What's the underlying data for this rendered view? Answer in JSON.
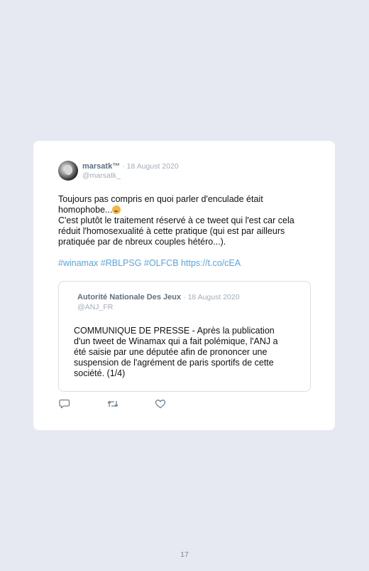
{
  "tweet": {
    "username": "marsatk™",
    "date": "· 18 August 2020",
    "handle": "@marsatk_",
    "text_line1": "Toujours pas compris en quoi parler d'enculade était homophobe...",
    "text_line2": "C'est plutôt le traitement réservé à ce tweet qui l'est car cela réduit l'homosexualité à cette pratique (qui est par ailleurs pratiquée par de nbreux couples hétéro...).",
    "emoji": "thinking-face",
    "hashtags": [
      "#winamax",
      "#RBLPSG",
      "#OLFCB"
    ],
    "link": "https://t.co/cEA"
  },
  "quoted_tweet": {
    "name": "Autorité Nationale Des Jeux",
    "date": "· 18 August 2020",
    "handle": "@ANJ_FR",
    "text": "COMMUNIQUE DE PRESSE - Après la publication d'un tweet de Winamax qui a fait polémique, l'ANJ a été saisie par une députée afin de prononcer une suspension de l'agrément de paris sportifs de cette société. (1/4)"
  },
  "actions": {
    "reply_icon": "reply-icon",
    "retweet_icon": "retweet-icon",
    "like_icon": "heart-icon"
  },
  "page": {
    "number": "17"
  },
  "colors": {
    "background": "#e6e9f1",
    "card": "#ffffff",
    "link": "#5aa4de",
    "muted": "#a3adb8"
  }
}
